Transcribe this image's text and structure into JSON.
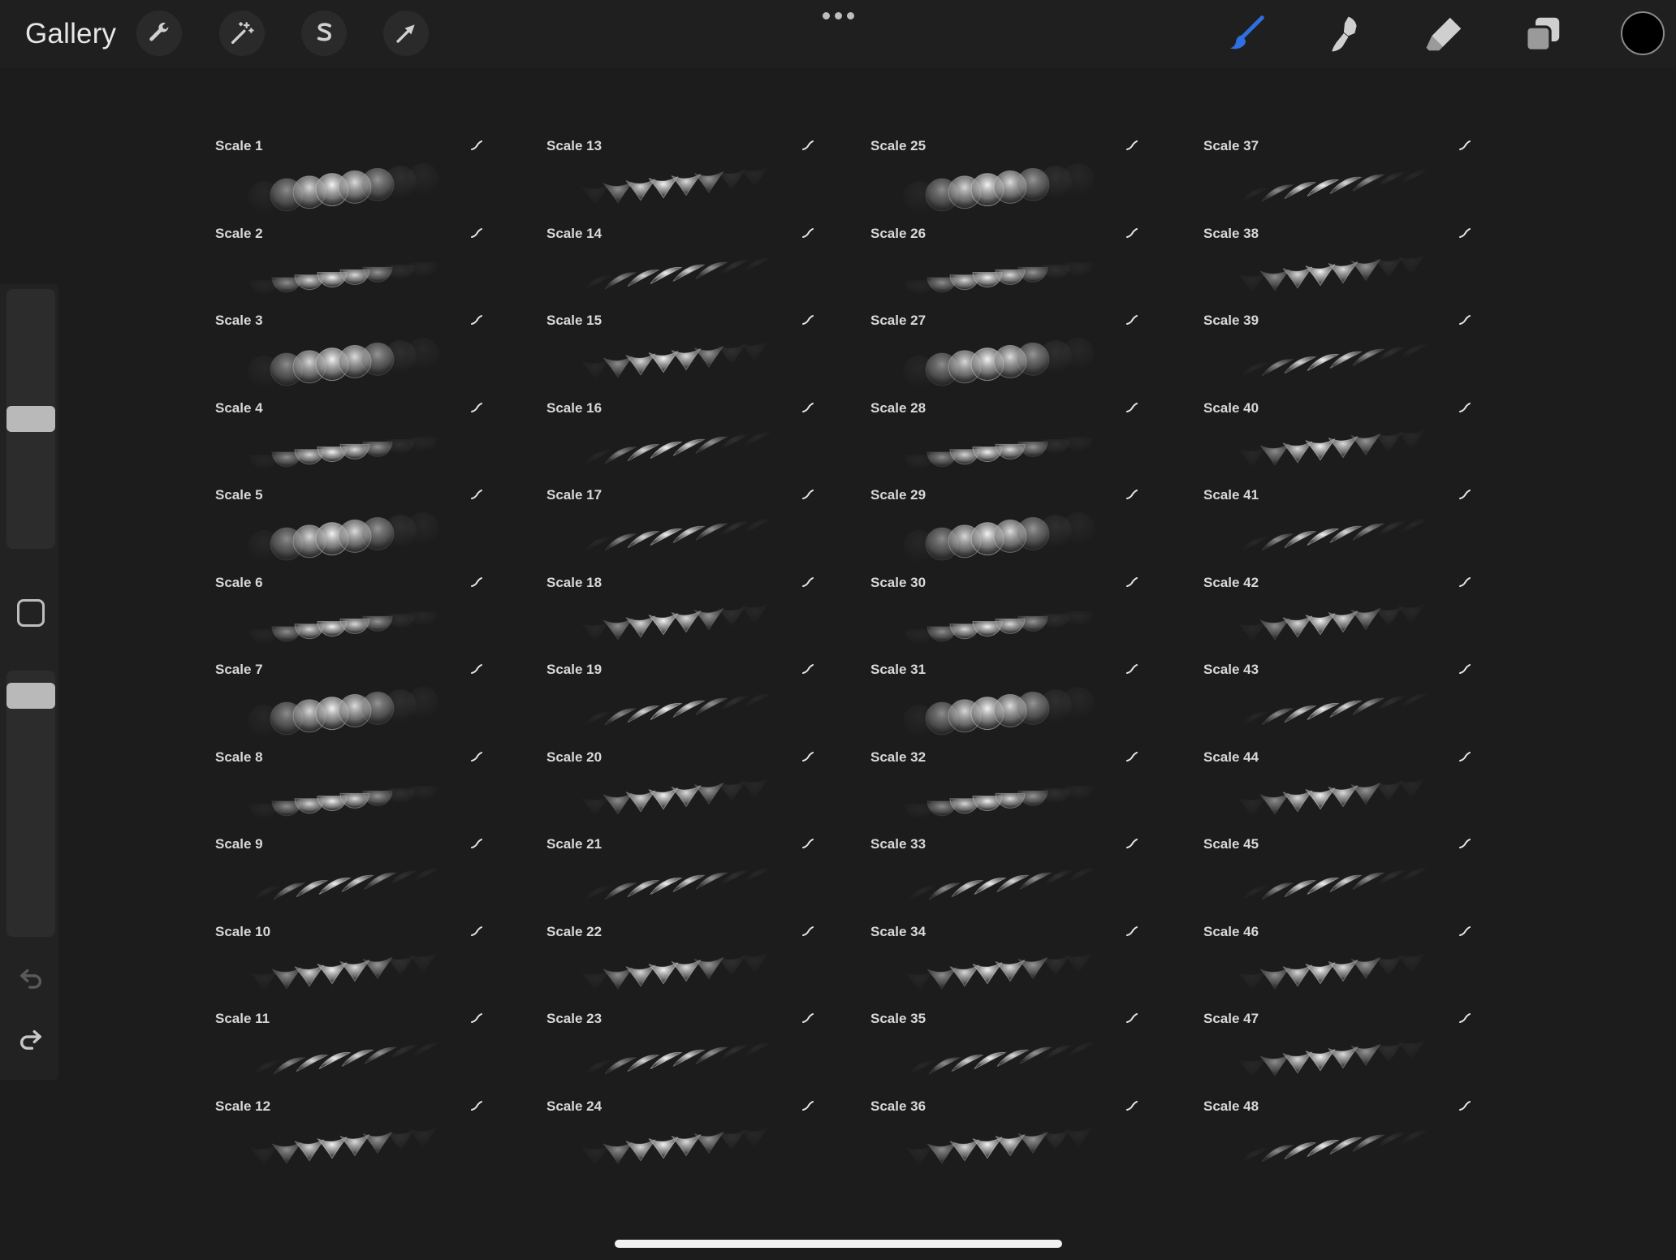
{
  "topbar": {
    "gallery_label": "Gallery",
    "left_tools": [
      "wrench-icon",
      "magic-wand-icon",
      "selection-s-icon",
      "arrow-cursor-icon"
    ],
    "right_tools": [
      "brush-icon",
      "smudge-icon",
      "eraser-icon",
      "layers-icon"
    ],
    "active_tool": "brush-icon",
    "accent_color": "#2f6fe0",
    "current_color": "#000000"
  },
  "sidebar": {
    "size_slider_level": 0.5,
    "opacity_slider_level": 0.95,
    "undo_icon": "undo-icon",
    "redo_icon": "redo-icon"
  },
  "brushes": {
    "columns": [
      [
        {
          "label": "Scale 1",
          "style": "round"
        },
        {
          "label": "Scale 2",
          "style": "cup"
        },
        {
          "label": "Scale 3",
          "style": "round"
        },
        {
          "label": "Scale 4",
          "style": "cup"
        },
        {
          "label": "Scale 5",
          "style": "round"
        },
        {
          "label": "Scale 6",
          "style": "cup"
        },
        {
          "label": "Scale 7",
          "style": "round"
        },
        {
          "label": "Scale 8",
          "style": "cup"
        },
        {
          "label": "Scale 9",
          "style": "feather"
        },
        {
          "label": "Scale 10",
          "style": "vee"
        },
        {
          "label": "Scale 11",
          "style": "feather"
        },
        {
          "label": "Scale 12",
          "style": "vee"
        }
      ],
      [
        {
          "label": "Scale 13",
          "style": "vee"
        },
        {
          "label": "Scale 14",
          "style": "feather"
        },
        {
          "label": "Scale 15",
          "style": "vee"
        },
        {
          "label": "Scale 16",
          "style": "feather"
        },
        {
          "label": "Scale 17",
          "style": "feather"
        },
        {
          "label": "Scale 18",
          "style": "vee"
        },
        {
          "label": "Scale 19",
          "style": "feather"
        },
        {
          "label": "Scale 20",
          "style": "vee"
        },
        {
          "label": "Scale 21",
          "style": "feather"
        },
        {
          "label": "Scale 22",
          "style": "vee"
        },
        {
          "label": "Scale 23",
          "style": "feather"
        },
        {
          "label": "Scale 24",
          "style": "vee"
        }
      ],
      [
        {
          "label": "Scale 25",
          "style": "round"
        },
        {
          "label": "Scale 26",
          "style": "cup"
        },
        {
          "label": "Scale 27",
          "style": "round"
        },
        {
          "label": "Scale 28",
          "style": "cup"
        },
        {
          "label": "Scale 29",
          "style": "round"
        },
        {
          "label": "Scale 30",
          "style": "cup"
        },
        {
          "label": "Scale 31",
          "style": "round"
        },
        {
          "label": "Scale 32",
          "style": "cup"
        },
        {
          "label": "Scale 33",
          "style": "feather"
        },
        {
          "label": "Scale 34",
          "style": "vee"
        },
        {
          "label": "Scale 35",
          "style": "feather"
        },
        {
          "label": "Scale 36",
          "style": "vee"
        }
      ],
      [
        {
          "label": "Scale 37",
          "style": "feather"
        },
        {
          "label": "Scale 38",
          "style": "vee"
        },
        {
          "label": "Scale 39",
          "style": "feather"
        },
        {
          "label": "Scale 40",
          "style": "vee"
        },
        {
          "label": "Scale 41",
          "style": "feather"
        },
        {
          "label": "Scale 42",
          "style": "vee"
        },
        {
          "label": "Scale 43",
          "style": "feather"
        },
        {
          "label": "Scale 44",
          "style": "vee"
        },
        {
          "label": "Scale 45",
          "style": "feather"
        },
        {
          "label": "Scale 46",
          "style": "vee"
        },
        {
          "label": "Scale 47",
          "style": "vee"
        },
        {
          "label": "Scale 48",
          "style": "feather"
        }
      ]
    ]
  }
}
